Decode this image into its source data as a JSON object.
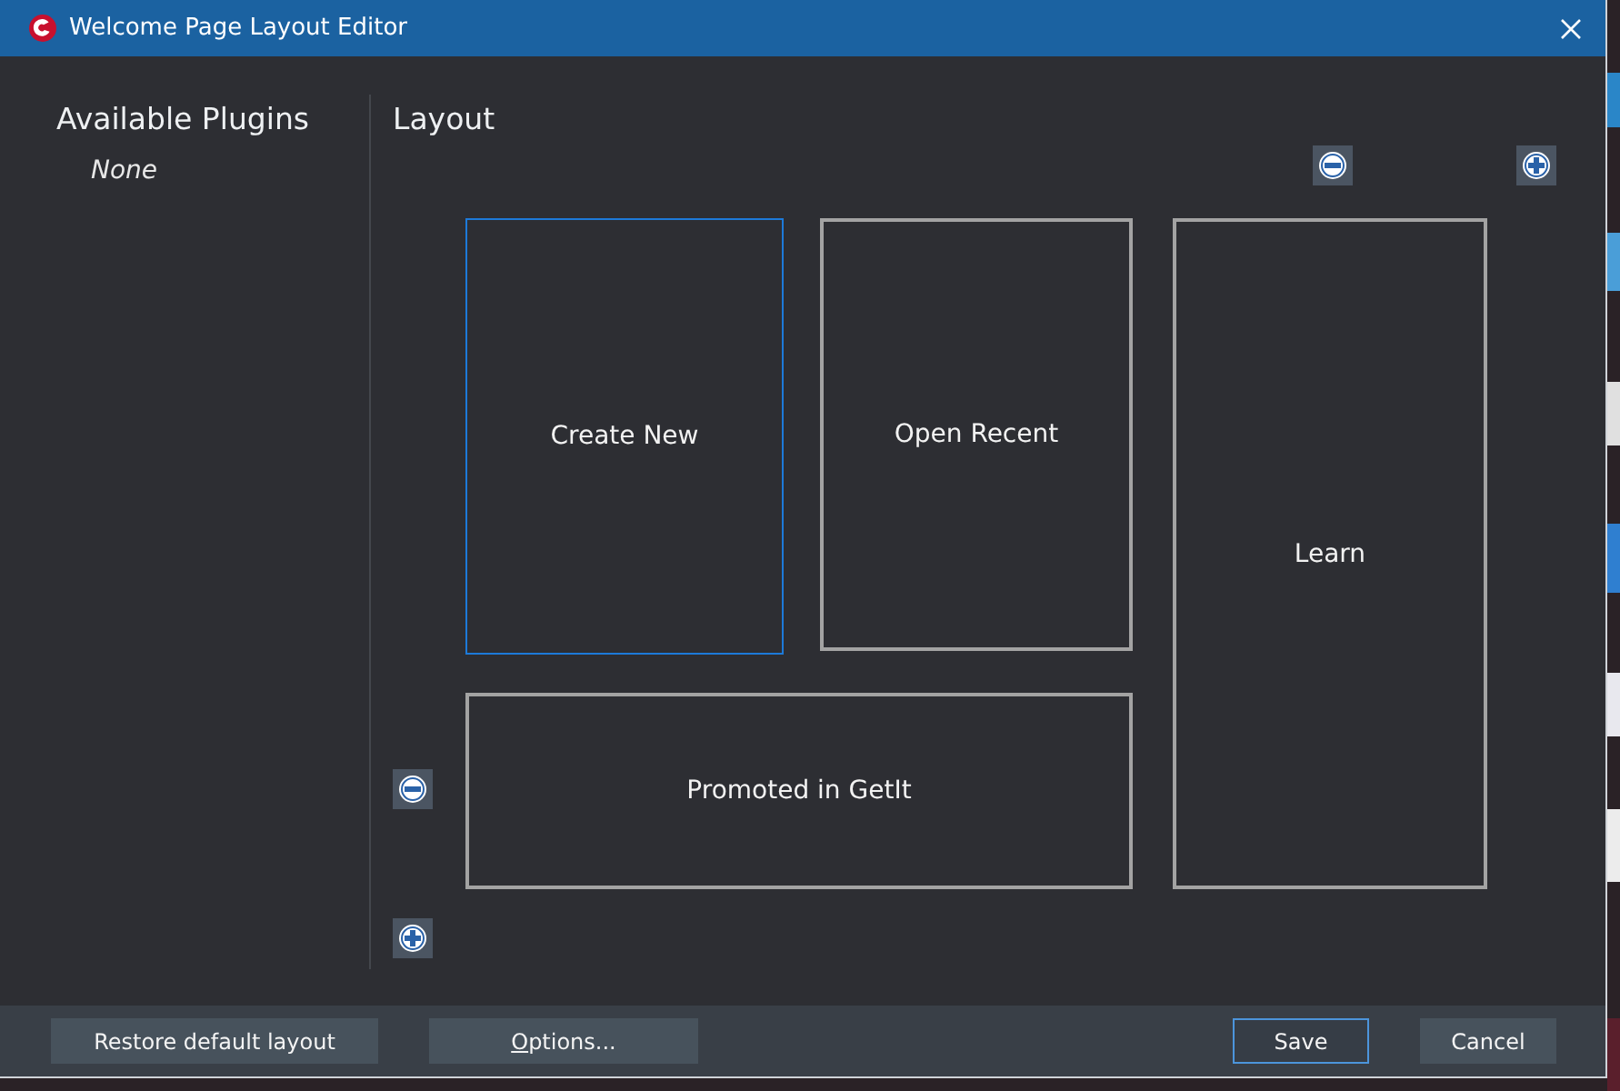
{
  "window": {
    "title": "Welcome Page Layout Editor"
  },
  "plugins": {
    "title": "Available Plugins",
    "items": [
      "None"
    ]
  },
  "layout": {
    "title": "Layout",
    "tiles": [
      {
        "label": "Create New",
        "selected": true
      },
      {
        "label": "Open Recent",
        "selected": false
      },
      {
        "label": "Learn",
        "selected": false
      },
      {
        "label": "Promoted in GetIt",
        "selected": false
      }
    ]
  },
  "buttons": [
    {
      "label": "Restore default layout",
      "access_key_underlined": false,
      "focused": false
    },
    {
      "label": "Options...",
      "access_key_underlined": true,
      "focused": false
    },
    {
      "label": "Save",
      "access_key_underlined": false,
      "focused": true
    },
    {
      "label": "Cancel",
      "access_key_underlined": false,
      "focused": false
    }
  ]
}
